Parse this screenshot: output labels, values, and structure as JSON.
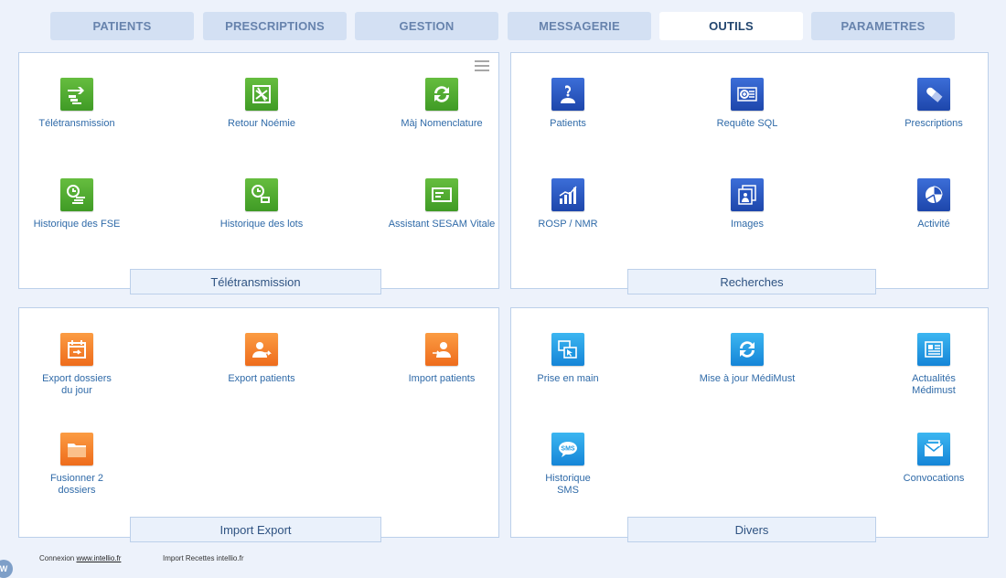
{
  "tabs": [
    {
      "label": "PATIENTS"
    },
    {
      "label": "PRESCRIPTIONS"
    },
    {
      "label": "GESTION"
    },
    {
      "label": "MESSAGERIE"
    },
    {
      "label": "OUTILS"
    },
    {
      "label": "PARAMETRES"
    }
  ],
  "active_tab": "OUTILS",
  "panels": {
    "teletransmission": {
      "title": "Télétransmission",
      "items": [
        {
          "label": "Télétransmission",
          "icon": "transmission-icon"
        },
        {
          "label": "Retour Noémie",
          "icon": "noemie-icon"
        },
        {
          "label": "Màj Nomenclature",
          "icon": "refresh-icon"
        },
        {
          "label": "Historique des FSE",
          "icon": "history-fse-icon"
        },
        {
          "label": "Historique des lots",
          "icon": "history-lots-icon"
        },
        {
          "label": "Assistant SESAM Vitale",
          "icon": "card-icon"
        }
      ]
    },
    "recherches": {
      "title": "Recherches",
      "items": [
        {
          "label": "Patients",
          "icon": "patient-search-icon"
        },
        {
          "label": "Requête SQL",
          "icon": "sql-query-icon"
        },
        {
          "label": "Prescriptions",
          "icon": "pill-icon"
        },
        {
          "label": "ROSP / NMR",
          "icon": "bar-chart-icon"
        },
        {
          "label": "Images",
          "icon": "images-icon"
        },
        {
          "label": "Activité",
          "icon": "pie-chart-icon"
        }
      ]
    },
    "import_export": {
      "title": "Import Export",
      "items": [
        {
          "label": "Export dossiers du jour",
          "icon": "calendar-export-icon"
        },
        {
          "label": "Export patients",
          "icon": "user-export-icon"
        },
        {
          "label": "Import patients",
          "icon": "user-import-icon"
        },
        {
          "label": "Fusionner 2 dossiers",
          "icon": "folder-icon"
        }
      ]
    },
    "divers": {
      "title": "Divers",
      "items": [
        {
          "label": "Prise en main",
          "icon": "remote-control-icon"
        },
        {
          "label": "Mise à jour MédiMust",
          "icon": "update-icon"
        },
        {
          "label": "Actualités Médimust",
          "icon": "news-icon"
        },
        {
          "label": "Historique SMS",
          "icon": "sms-icon"
        },
        {
          "label": "Convocations",
          "icon": "mail-icon"
        }
      ]
    }
  },
  "footer": {
    "connexion_label": "Connexion",
    "connexion_link": "www.intellio.fr",
    "import_text": "Import Recettes intellio.fr",
    "logo_text": "W"
  },
  "colors": {
    "background": "#edf2fb",
    "tab_bg": "#d3e0f3",
    "tab_text": "#6783ad",
    "tab_active_text": "#23466f",
    "panel_border": "#bcd0ea",
    "green": "#4aa82d",
    "blue": "#2452bd",
    "orange": "#f47f28",
    "cyan": "#1d97e2",
    "label": "#2f6aa8"
  }
}
